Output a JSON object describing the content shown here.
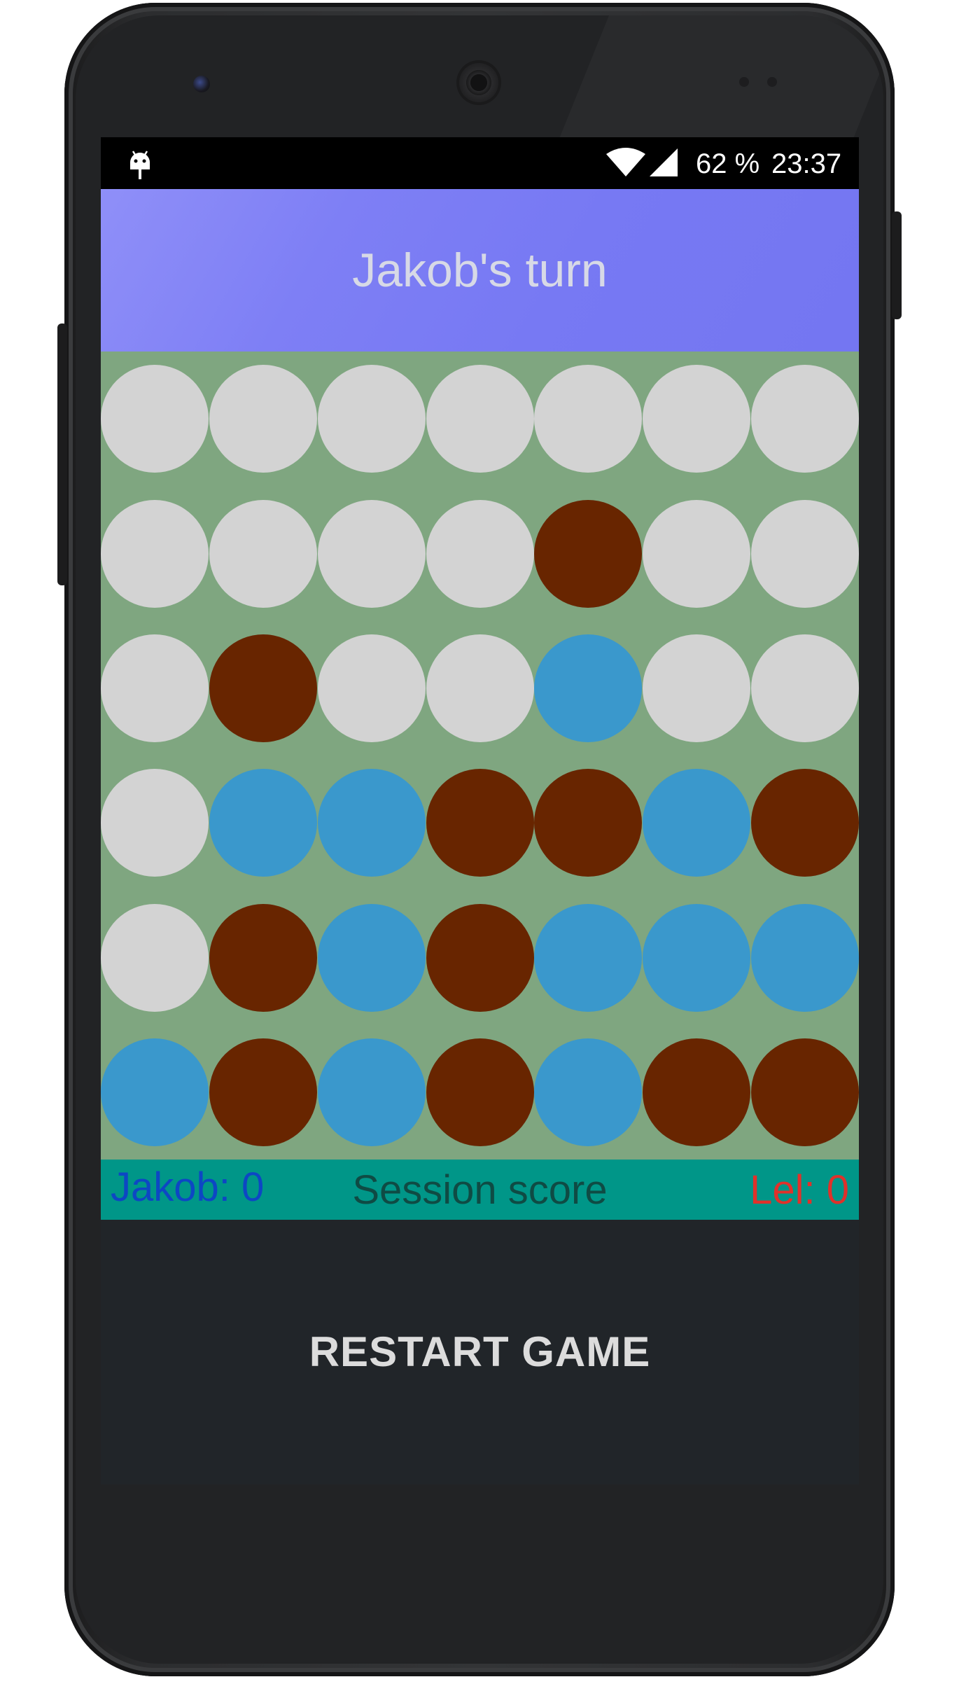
{
  "status_bar": {
    "battery": "62 %",
    "time": "23:37",
    "icons": [
      "android-debug-icon",
      "wifi-icon",
      "signal-icon"
    ]
  },
  "header": {
    "turn_text": "Jakob's turn",
    "background": "#7b7cf4",
    "text_color": "#d7d9e6"
  },
  "board": {
    "columns": 7,
    "rows": 6,
    "background": "#7fa680",
    "colors": {
      "empty": "#d3d3d3",
      "player1": "#3a98cc",
      "player2": "#682500"
    },
    "cells": [
      [
        "empty",
        "empty",
        "empty",
        "empty",
        "empty",
        "empty",
        "empty"
      ],
      [
        "empty",
        "empty",
        "empty",
        "empty",
        "player2",
        "empty",
        "empty"
      ],
      [
        "empty",
        "player2",
        "empty",
        "empty",
        "player1",
        "empty",
        "empty"
      ],
      [
        "empty",
        "player1",
        "player1",
        "player2",
        "player2",
        "player1",
        "player2"
      ],
      [
        "empty",
        "player2",
        "player1",
        "player2",
        "player1",
        "player1",
        "player1"
      ],
      [
        "player1",
        "player2",
        "player1",
        "player2",
        "player1",
        "player2",
        "player2"
      ]
    ]
  },
  "score": {
    "player1": "Jakob: 0",
    "title": "Session score",
    "player2": "Lel: 0",
    "background": "#009688"
  },
  "restart_label": "RESTART GAME"
}
